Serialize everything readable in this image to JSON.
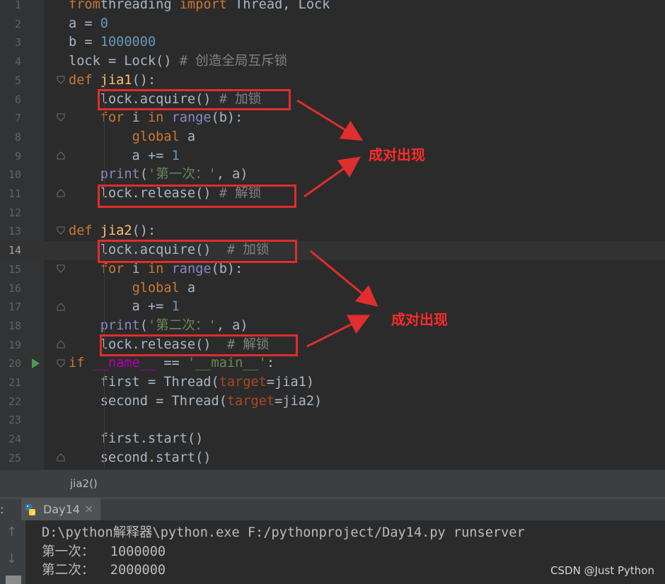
{
  "editor": {
    "current_line": 14,
    "lines": [
      {
        "n": "1",
        "tokens": [
          [
            "kw",
            "from"
          ],
          [
            "",
            "threading "
          ],
          [
            "kw",
            "import"
          ],
          [
            "",
            " Thread, Lock"
          ]
        ]
      },
      {
        "n": "2",
        "tokens": [
          [
            "",
            "a = "
          ],
          [
            "num",
            "0"
          ]
        ]
      },
      {
        "n": "3",
        "tokens": [
          [
            "",
            "b = "
          ],
          [
            "num",
            "1000000"
          ]
        ]
      },
      {
        "n": "4",
        "tokens": [
          [
            "",
            "lock = Lock() "
          ],
          [
            "cm",
            "# 创造全局互斥锁"
          ]
        ]
      },
      {
        "n": "5",
        "tokens": [
          [
            "kw",
            "def "
          ],
          [
            "fn",
            "jia1"
          ],
          [
            "",
            "():"
          ]
        ]
      },
      {
        "n": "6",
        "tokens": [
          [
            "",
            "    lock.acquire() "
          ],
          [
            "cm",
            "# 加锁"
          ]
        ]
      },
      {
        "n": "7",
        "tokens": [
          [
            "",
            "    "
          ],
          [
            "kw",
            "for"
          ],
          [
            "",
            " i "
          ],
          [
            "kw",
            "in"
          ],
          [
            "",
            " "
          ],
          [
            "bi",
            "range"
          ],
          [
            "",
            "(b):"
          ]
        ]
      },
      {
        "n": "8",
        "tokens": [
          [
            "",
            "        "
          ],
          [
            "kw",
            "global"
          ],
          [
            "",
            " a"
          ]
        ]
      },
      {
        "n": "9",
        "tokens": [
          [
            "",
            "        a += "
          ],
          [
            "num",
            "1"
          ]
        ]
      },
      {
        "n": "10",
        "tokens": [
          [
            "",
            "    "
          ],
          [
            "bi",
            "print"
          ],
          [
            "",
            "("
          ],
          [
            "str",
            "'第一次：'"
          ],
          [
            "",
            ", a)"
          ]
        ]
      },
      {
        "n": "11",
        "tokens": [
          [
            "",
            "    lock.release() "
          ],
          [
            "cm",
            "# 解锁"
          ]
        ]
      },
      {
        "n": "12",
        "tokens": []
      },
      {
        "n": "13",
        "tokens": [
          [
            "kw",
            "def "
          ],
          [
            "fn",
            "jia2"
          ],
          [
            "",
            "():"
          ]
        ]
      },
      {
        "n": "14",
        "tokens": [
          [
            "",
            "    lock.acquire()  "
          ],
          [
            "cm",
            "# 加锁"
          ]
        ]
      },
      {
        "n": "15",
        "tokens": [
          [
            "",
            "    "
          ],
          [
            "kw",
            "for"
          ],
          [
            "",
            " i "
          ],
          [
            "kw",
            "in"
          ],
          [
            "",
            " "
          ],
          [
            "bi",
            "range"
          ],
          [
            "",
            "(b):"
          ]
        ]
      },
      {
        "n": "16",
        "tokens": [
          [
            "",
            "        "
          ],
          [
            "kw",
            "global"
          ],
          [
            "",
            " a"
          ]
        ]
      },
      {
        "n": "17",
        "tokens": [
          [
            "",
            "        a += "
          ],
          [
            "num",
            "1"
          ]
        ]
      },
      {
        "n": "18",
        "tokens": [
          [
            "",
            "    "
          ],
          [
            "bi",
            "print"
          ],
          [
            "",
            "("
          ],
          [
            "str",
            "'第二次：'"
          ],
          [
            "",
            ", a)"
          ]
        ]
      },
      {
        "n": "19",
        "tokens": [
          [
            "",
            "    lock.release()  "
          ],
          [
            "cm",
            "# 解锁"
          ]
        ]
      },
      {
        "n": "20",
        "tokens": [
          [
            "kw",
            "if"
          ],
          [
            "",
            " "
          ],
          [
            "mag",
            "__name__"
          ],
          [
            "",
            " == "
          ],
          [
            "str",
            "'__main__'"
          ],
          [
            "",
            ":"
          ]
        ]
      },
      {
        "n": "21",
        "tokens": [
          [
            "",
            "    first = Thread("
          ],
          [
            "pm",
            "target"
          ],
          [
            "",
            "=jia1)"
          ]
        ]
      },
      {
        "n": "22",
        "tokens": [
          [
            "",
            "    second = Thread("
          ],
          [
            "pm",
            "target"
          ],
          [
            "",
            "=jia2)"
          ]
        ]
      },
      {
        "n": "23",
        "tokens": []
      },
      {
        "n": "24",
        "tokens": [
          [
            "",
            "    first.start()"
          ]
        ]
      },
      {
        "n": "25",
        "tokens": [
          [
            "",
            "    second.start()"
          ]
        ]
      }
    ]
  },
  "annotations": {
    "label_1": "成对出现",
    "label_2": "成对出现"
  },
  "breadcrumb": "jia2()",
  "run_panel": {
    "colon": ":",
    "tab_label": "Day14",
    "tab_close": "×",
    "rerun_icon": "arrow-up-icon",
    "stop_icon": "arrow-down-icon"
  },
  "console": {
    "lines": [
      "D:\\python解释器\\python.exe F:/pythonproject/Day14.py runserver",
      "第一次：  1000000",
      "第二次：  2000000"
    ]
  },
  "watermark": "CSDN @Just Python",
  "colors": {
    "keyword": "#cc7832",
    "number": "#6897bb",
    "comment": "#808080",
    "string": "#6a8759",
    "function": "#ffc66d",
    "annotation_red": "#e02d2d"
  }
}
